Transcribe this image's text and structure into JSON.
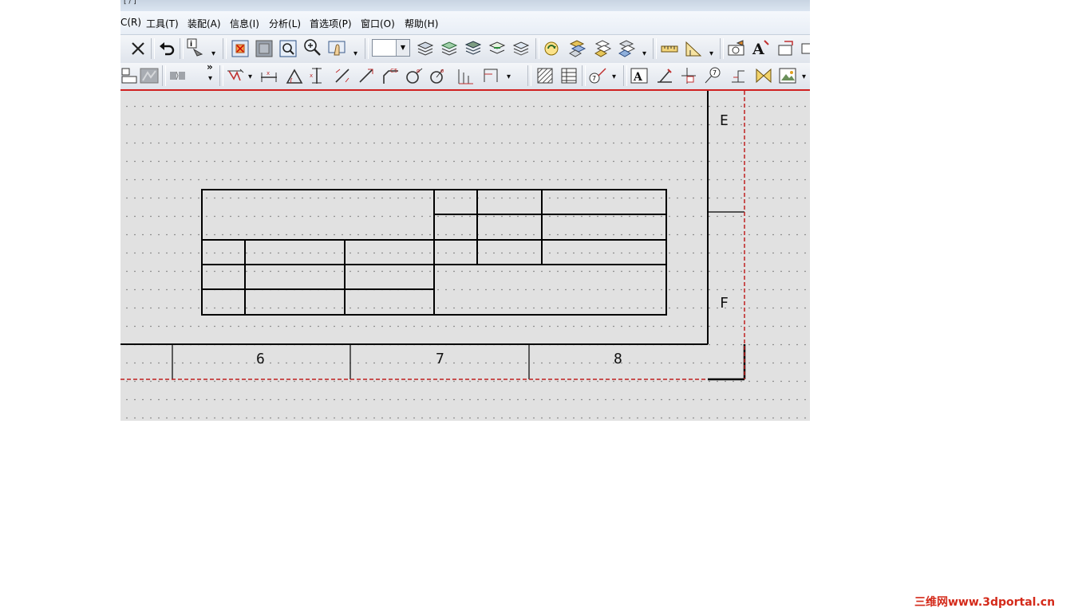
{
  "title_strip": "[ / ]",
  "menu": [
    {
      "label": "C(R)"
    },
    {
      "label": "工具(T)"
    },
    {
      "label": "装配(A)"
    },
    {
      "label": "信息(I)"
    },
    {
      "label": "分析(L)"
    },
    {
      "label": "首选项(P)"
    },
    {
      "label": "窗口(O)"
    },
    {
      "label": "帮助(H)"
    }
  ],
  "toolbar": {
    "overflow": "»",
    "layer_combo_value": ""
  },
  "drawing": {
    "zone_columns": [
      "6",
      "7",
      "8"
    ],
    "zone_rows": [
      "E",
      "F"
    ]
  },
  "watermark": "三维网www.3dportal.cn",
  "colors": {
    "canvas": "#e1e1e1",
    "border_red_dash": "#d02020",
    "accent_red": "#d42a1a"
  }
}
